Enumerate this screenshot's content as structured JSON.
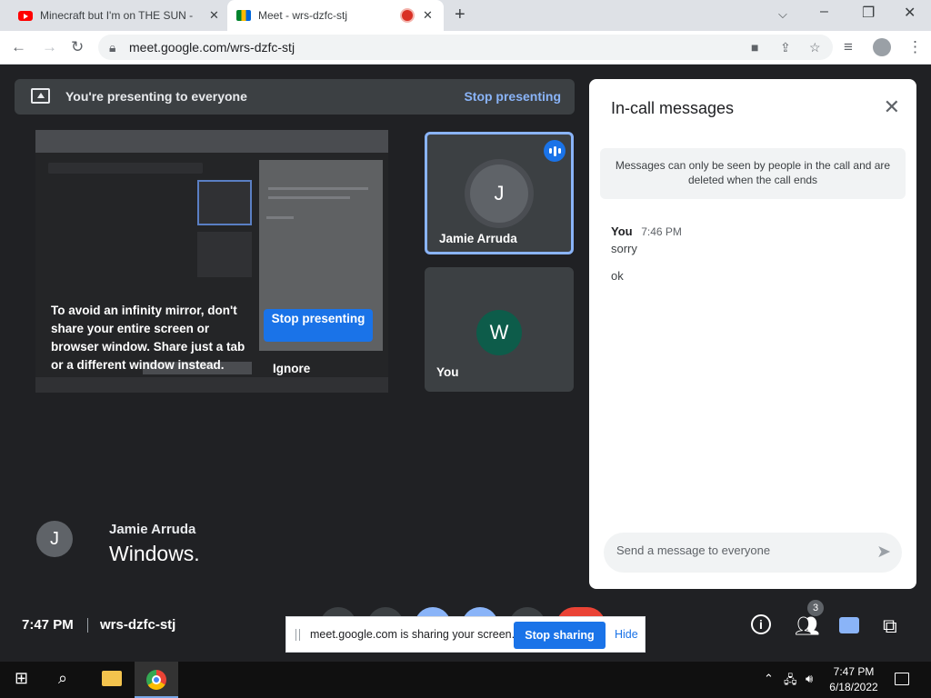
{
  "browser": {
    "tabs": [
      {
        "title": "Minecraft but I'm on THE SUN - Y",
        "icon": "youtube-icon"
      },
      {
        "title": "Meet - wrs-dzfc-stj",
        "icon": "meet-icon"
      }
    ],
    "url": "meet.google.com/wrs-dzfc-stj"
  },
  "meet": {
    "presenting_bar": {
      "text": "You're presenting to everyone",
      "stop_label": "Stop presenting"
    },
    "mirror_warning": {
      "text": "To avoid an infinity mirror, don't share your entire screen or browser window. Share just a tab or a different window instead.",
      "stop_label": "Stop presenting",
      "ignore_label": "Ignore"
    },
    "participants": [
      {
        "name": "Jamie Arruda",
        "initial": "J",
        "speaking": true
      },
      {
        "name": "You",
        "initial": "W",
        "speaking": false
      }
    ],
    "caption": {
      "initial": "J",
      "speaker": "Jamie Arruda",
      "text": "Windows."
    },
    "bottom": {
      "time": "7:47 PM",
      "meeting_code": "wrs-dzfc-stj",
      "people_count": "3"
    }
  },
  "chat": {
    "title": "In-call messages",
    "notice": "Messages can only be seen by people in the call and are deleted when the call ends",
    "messages": [
      {
        "sender": "You",
        "time": "7:46 PM",
        "lines": [
          "sorry",
          "ok"
        ]
      }
    ],
    "input_placeholder": "Send a message to everyone"
  },
  "share_banner": {
    "text": "meet.google.com is sharing your screen.",
    "stop_label": "Stop sharing",
    "hide_label": "Hide"
  },
  "taskbar": {
    "time": "7:47 PM",
    "date": "6/18/2022"
  },
  "colors": {
    "accent": "#1a73e8",
    "link": "#8ab4f8",
    "stage_bg": "#202124",
    "tile_bg": "#3c4043",
    "record": "#d93025"
  }
}
